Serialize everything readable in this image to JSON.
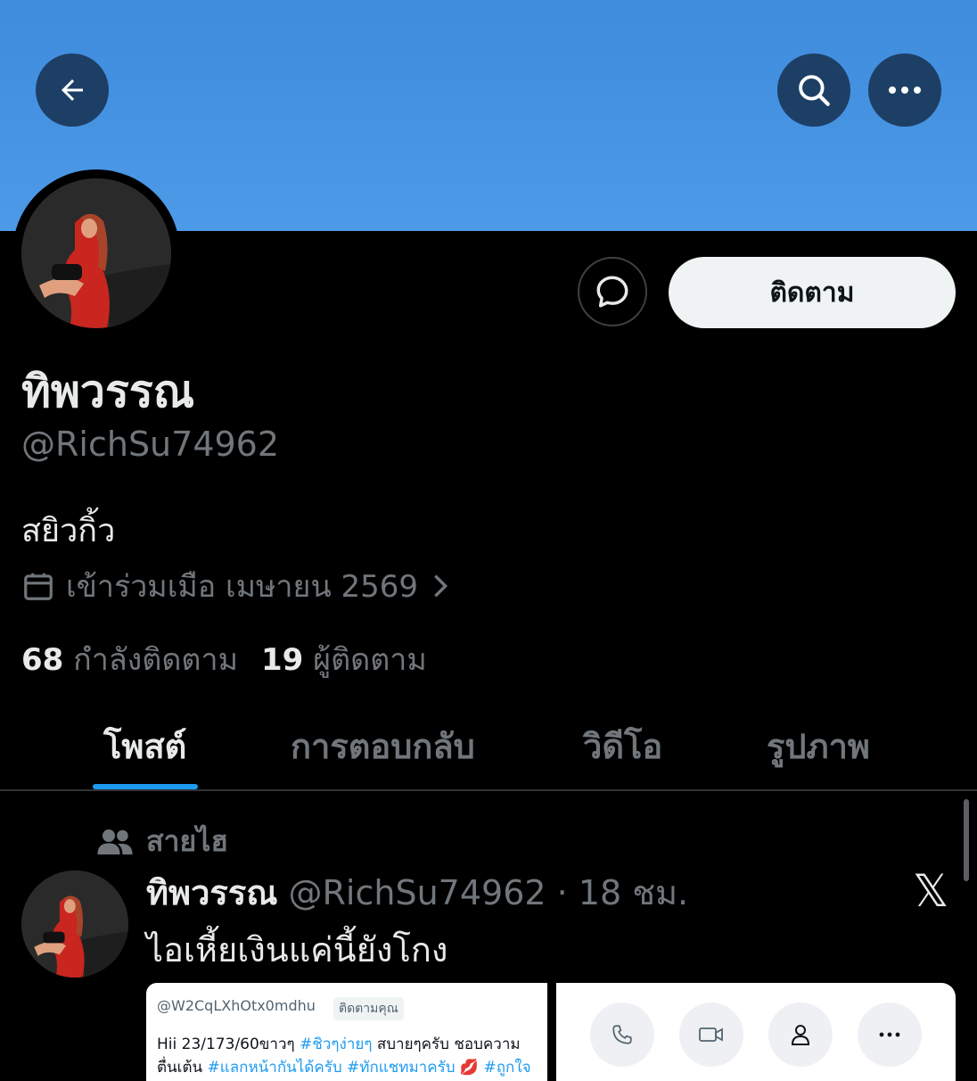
{
  "header": {
    "back_icon": "arrow-left-icon",
    "search_icon": "search-icon",
    "more_icon": "more-horizontal-icon",
    "banner_color": "#4a96e4"
  },
  "profile": {
    "name": "ทิพวรรณ",
    "handle": "@RichSu74962",
    "bio": "สยิวกิ้ว",
    "joined": "เข้าร่วมเมือ เมษายน 2569",
    "follow_label": "ติดตาม",
    "following_count": "68",
    "following_label": "กำลังติดตาม",
    "followers_count": "19",
    "followers_label": "ผู้ติดตาม"
  },
  "tabs": [
    {
      "label": "โพสต์",
      "active": true
    },
    {
      "label": "การตอบกลับ",
      "active": false
    },
    {
      "label": "วิดีโอ",
      "active": false
    },
    {
      "label": "รูปภาพ",
      "active": false
    }
  ],
  "post": {
    "pinned_label": "สายไฮ",
    "author_name": "ทิพวรรณ",
    "author_meta": "@RichSu74962 · 18 ชม.",
    "text": "ไอเหี้ยเงินแค่นี้ยังโกง",
    "media1": {
      "handle": "@W2CqLXhOtx0mdhu",
      "badge": "ติดตามคุณ",
      "line1_plain": "Hii 23/173/60ขาวๆ ",
      "line1_tag": "#ชิวๆง่ายๆ",
      "line1_rest": " สบายๆครับ ชอบความ",
      "line2_plain": "ตื่นเต้น ",
      "line2_tag": "#แลกหน้ากันได้ครับ #ทักแชทมาครับ 💋 #ถูกใจ"
    }
  },
  "colors": {
    "accent": "#1d9bf0",
    "muted": "#71767b",
    "text": "#e7e9ea"
  }
}
